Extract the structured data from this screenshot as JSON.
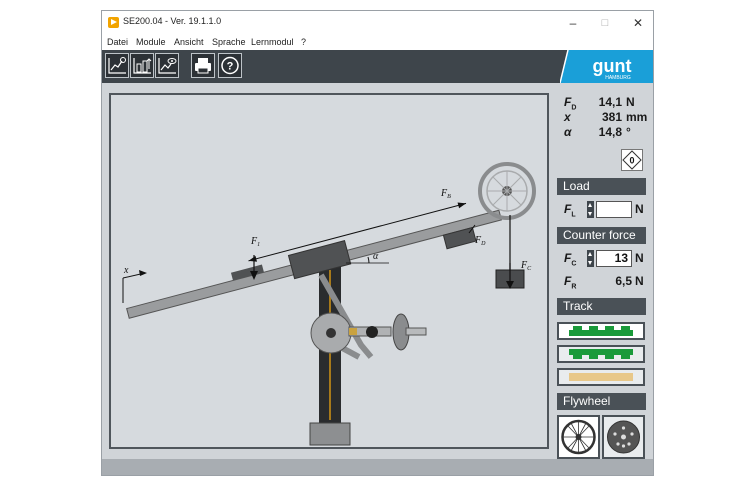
{
  "window": {
    "title": "SE200.04 - Ver. 19.1.1.0",
    "controls": {
      "minimize": "–",
      "maximize": "□",
      "close": "✕"
    }
  },
  "menu": [
    "Datei",
    "Module",
    "Ansicht",
    "Sprache",
    "Lernmodul",
    "?"
  ],
  "toolbar": {
    "buttons": [
      "chart-icon",
      "data-chart-icon",
      "view-chart-icon",
      "print-icon",
      "help-icon"
    ],
    "logo_text": "gunt",
    "logo_sub": "HAMBURG"
  },
  "diagram": {
    "labels": {
      "fb": "F",
      "fb_sub": "B",
      "f1": "F",
      "f1_sub": "1",
      "fd": "F",
      "fd_sub": "D",
      "fc": "F",
      "fc_sub": "C",
      "x": "x",
      "alpha": "α"
    }
  },
  "readouts": {
    "fd": {
      "symbol": "F",
      "sub": "D",
      "value": "14,1",
      "unit": "N"
    },
    "x": {
      "symbol": "x",
      "value": "381",
      "unit": "mm"
    },
    "alpha": {
      "symbol": "α",
      "value": "14,8",
      "unit": "°"
    }
  },
  "zero_button_label": "0",
  "load": {
    "heading": "Load",
    "symbol": "F",
    "sub": "L",
    "value": "",
    "unit": "N"
  },
  "counter_force": {
    "heading": "Counter force",
    "fc": {
      "symbol": "F",
      "sub": "C",
      "value": "13",
      "unit": "N"
    },
    "fr": {
      "symbol": "F",
      "sub": "R",
      "value": "6,5",
      "unit": "N"
    }
  },
  "track": {
    "heading": "Track",
    "options": [
      "track-rack-up",
      "track-rack-down",
      "track-smooth"
    ]
  },
  "flywheel": {
    "heading": "Flywheel",
    "options": [
      "spoked-flywheel",
      "solid-flywheel"
    ]
  },
  "colors": {
    "toolbar": "#3e454b",
    "accent_green": "#1a9a3a",
    "section_header": "#4a5157",
    "smooth_track": "#e8c88a"
  }
}
